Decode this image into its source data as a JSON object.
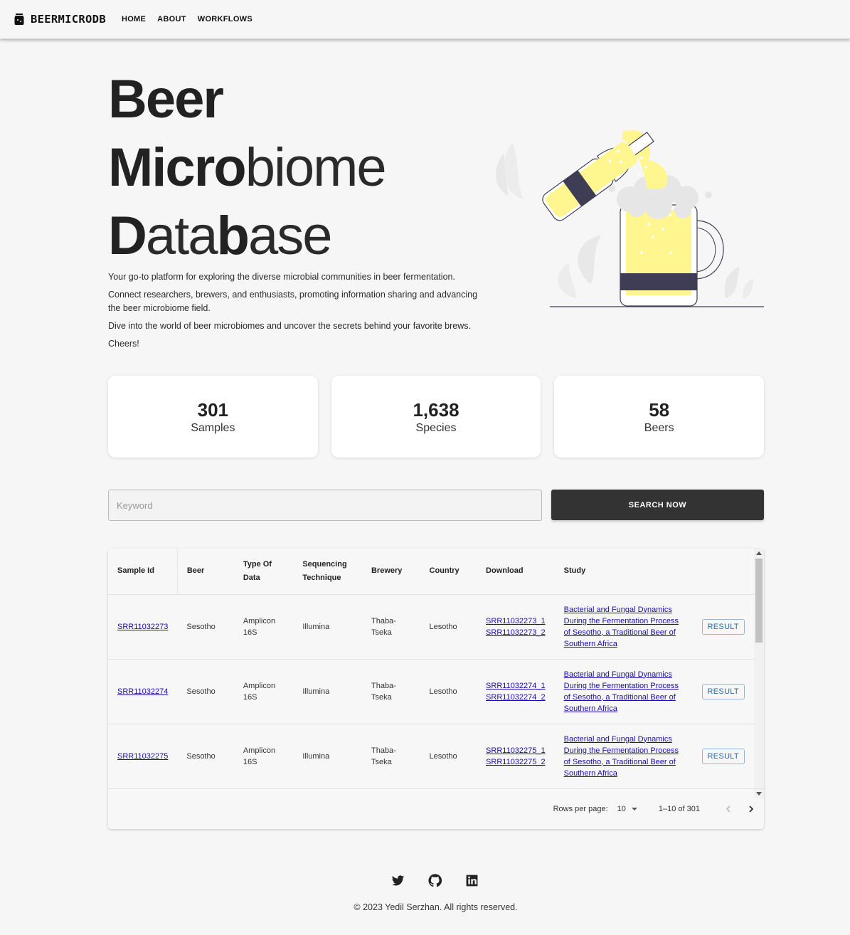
{
  "nav": {
    "logo_text": "BEERMICRODB",
    "links": [
      "HOME",
      "ABOUT",
      "WORKFLOWS"
    ]
  },
  "hero": {
    "line1": [
      "Beer"
    ],
    "line2": [
      "Micro",
      "biome"
    ],
    "line3": [
      "D",
      "ata",
      "b",
      "ase"
    ],
    "paragraphs": [
      "Your go-to platform for exploring the diverse microbial communities in beer fermentation.",
      "Connect researchers, brewers, and enthusiasts, promoting information sharing and advancing the beer microbiome field.",
      "Dive into the world of beer microbiomes and uncover the secrets behind your favorite brews.",
      "Cheers!"
    ]
  },
  "stats": [
    {
      "value": "301",
      "label": "Samples"
    },
    {
      "value": "1,638",
      "label": "Species"
    },
    {
      "value": "58",
      "label": "Beers"
    }
  ],
  "search": {
    "placeholder": "Keyword",
    "button_label": "SEARCH NOW"
  },
  "table": {
    "headers": [
      "Sample Id",
      "Beer",
      "Type Of Data",
      "Sequencing Technique",
      "Brewery",
      "Country",
      "Download",
      "Study"
    ],
    "rows": [
      {
        "sample_id": "SRR11032273",
        "beer": "Sesotho",
        "type": "Amplicon 16S",
        "technique": "Illumina",
        "brewery": "Thaba-Tseka",
        "country": "Lesotho",
        "download_1": "SRR11032273_1",
        "download_2": "SRR11032273_2",
        "study": "Bacterial and Fungal Dynamics During the Fermentation Process of Sesotho, a Traditional Beer of Southern Africa",
        "action": "RESULT"
      },
      {
        "sample_id": "SRR11032274",
        "beer": "Sesotho",
        "type": "Amplicon 16S",
        "technique": "Illumina",
        "brewery": "Thaba-Tseka",
        "country": "Lesotho",
        "download_1": "SRR11032274_1",
        "download_2": "SRR11032274_2",
        "study": "Bacterial and Fungal Dynamics During the Fermentation Process of Sesotho, a Traditional Beer of Southern Africa",
        "action": "RESULT"
      },
      {
        "sample_id": "SRR11032275",
        "beer": "Sesotho",
        "type": "Amplicon 16S",
        "technique": "Illumina",
        "brewery": "Thaba-Tseka",
        "country": "Lesotho",
        "download_1": "SRR11032275_1",
        "download_2": "SRR11032275_2",
        "study": "Bacterial and Fungal Dynamics During the Fermentation Process of Sesotho, a Traditional Beer of Southern Africa",
        "action": "RESULT"
      }
    ]
  },
  "pagination": {
    "rows_per_page_label": "Rows per page:",
    "rows_per_page_value": "10",
    "range_text": "1–10 of 301"
  },
  "footer": {
    "social_icons": [
      "twitter-icon",
      "github-icon",
      "linkedin-icon"
    ],
    "copyright": "© 2023 Yedil Serzhan. All rights reserved."
  },
  "colors": {
    "beer_yellow": "#fff68f",
    "label_dark": "#3f3d56",
    "button_dark": "#333333",
    "link_blue": "#1a0dab"
  }
}
